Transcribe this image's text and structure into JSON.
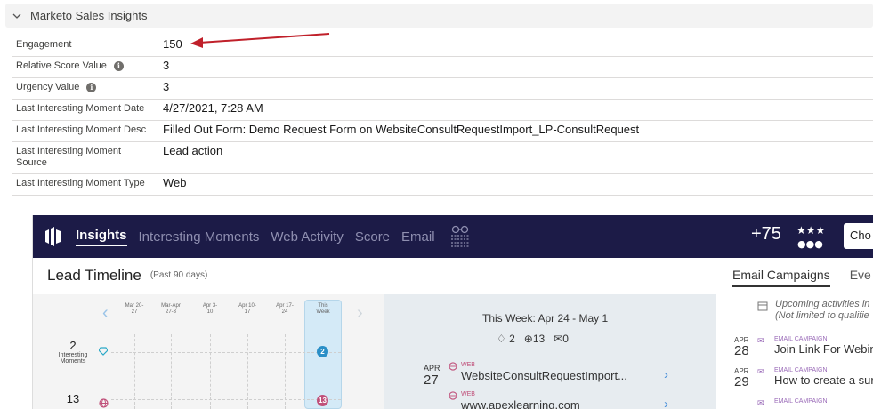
{
  "section": {
    "title": "Marketo Sales Insights"
  },
  "fields": [
    {
      "label": "Engagement",
      "value": "150",
      "info": false
    },
    {
      "label": "Relative Score Value",
      "value": "3",
      "info": true
    },
    {
      "label": "Urgency Value",
      "value": "3",
      "info": true
    },
    {
      "label": "Last Interesting Moment Date",
      "value": "4/27/2021, 7:28 AM",
      "info": false
    },
    {
      "label": "Last Interesting Moment Desc",
      "value": "Filled Out Form: Demo Request Form on WebsiteConsultRequestImport_LP-ConsultRequest",
      "info": false
    },
    {
      "label": "Last Interesting Moment Source",
      "value": "Lead action",
      "info": false
    },
    {
      "label": "Last Interesting Moment Type",
      "value": "Web",
      "info": false
    }
  ],
  "marketo": {
    "tabs": [
      "Insights",
      "Interesting Moments",
      "Web Activity",
      "Score",
      "Email"
    ],
    "score_change": "+75",
    "choose_label": "Cho",
    "timeline": {
      "title": "Lead Timeline",
      "subtitle": "(Past 90 days)",
      "weeks": [
        "Mar 20-27",
        "Mar-Apr 27-3",
        "Apr 3-10",
        "Apr 10-17",
        "Apr 17-24",
        "This Week"
      ],
      "metrics": [
        {
          "value": "2",
          "label": "Interesting Moments"
        },
        {
          "value": "13",
          "label": ""
        }
      ],
      "this_week_dots": [
        "2",
        "13"
      ]
    },
    "this_week": {
      "title": "This Week: Apr 24 - May 1",
      "moments": "2",
      "web": "13",
      "emails": "0",
      "activities": [
        {
          "month": "APR",
          "day": "27",
          "type": "WEB",
          "name": "WebsiteConsultRequestImport..."
        },
        {
          "month": "",
          "day": "",
          "type": "WEB",
          "name": "www.apexlearning.com"
        }
      ]
    },
    "right": {
      "tabs": [
        "Email Campaigns",
        "Eve"
      ],
      "upcoming": [
        "Upcoming activities in",
        "(Not limited to qualifie"
      ],
      "campaigns": [
        {
          "month": "APR",
          "day": "28",
          "type": "EMAIL CAMPAIGN",
          "name": "Join Link For Webin"
        },
        {
          "month": "APR",
          "day": "29",
          "type": "EMAIL CAMPAIGN",
          "name": "How to create a sur"
        },
        {
          "month": "",
          "day": "",
          "type": "EMAIL CAMPAIGN",
          "name": ""
        }
      ]
    }
  },
  "colors": {
    "nav_bg": "#1c1b47",
    "arrow": "#c0202a",
    "web_accent": "#c0507a",
    "email_accent": "#9a6bb8",
    "moment_dot": "#2a8fc7"
  }
}
